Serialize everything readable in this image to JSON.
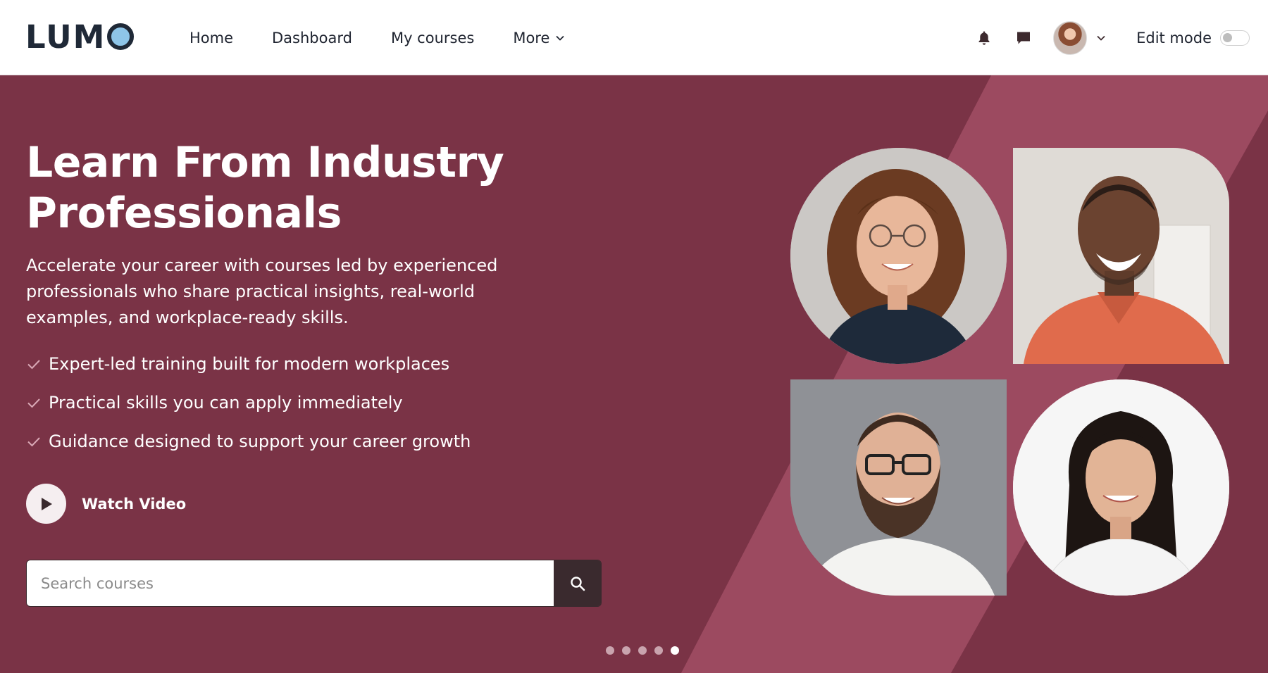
{
  "brand": {
    "name": "LUM"
  },
  "nav": {
    "links": [
      "Home",
      "Dashboard",
      "My courses",
      "More"
    ],
    "edit_mode_label": "Edit mode",
    "edit_mode_on": false
  },
  "icons": {
    "notifications": "bell-icon",
    "messages": "chat-icon",
    "user_menu": "chevron-down-icon",
    "search": "search-icon",
    "play": "play-icon"
  },
  "hero": {
    "title": "Learn From Industry Professionals",
    "description": "Accelerate your career with courses led by experienced professionals who share practical insights, real-world examples, and workplace-ready skills.",
    "features": [
      "Expert-led training built for modern workplaces",
      "Practical skills you can apply immediately",
      "Guidance designed to support your career growth"
    ],
    "watch_video_label": "Watch Video",
    "search_placeholder": "Search courses",
    "slide_count": 5,
    "active_slide": 5
  },
  "colors": {
    "hero_bg": "#7a3346",
    "hero_band": "#9c4a60",
    "search_button": "#3a2a2e",
    "logo_accent": "#8ec5e8"
  }
}
